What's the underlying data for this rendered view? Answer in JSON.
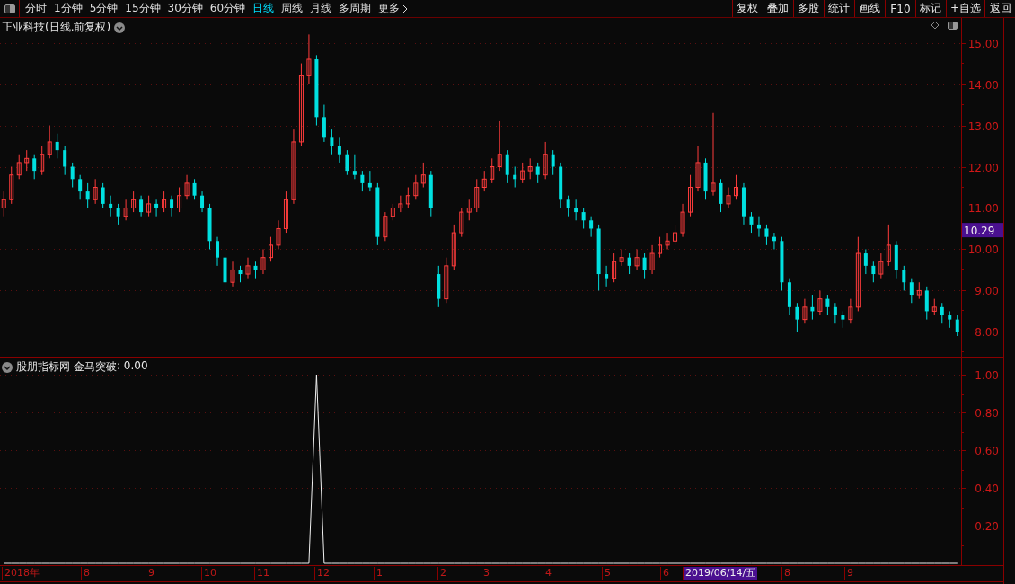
{
  "toolbar": {
    "periods": [
      {
        "label": "分时",
        "selected": false
      },
      {
        "label": "1分钟",
        "selected": false
      },
      {
        "label": "5分钟",
        "selected": false
      },
      {
        "label": "15分钟",
        "selected": false
      },
      {
        "label": "30分钟",
        "selected": false
      },
      {
        "label": "60分钟",
        "selected": false
      },
      {
        "label": "日线",
        "selected": true
      },
      {
        "label": "周线",
        "selected": false
      },
      {
        "label": "月线",
        "selected": false
      },
      {
        "label": "多周期",
        "selected": false
      },
      {
        "label": "更多",
        "selected": false
      }
    ],
    "buttons": [
      "复权",
      "叠加",
      "多股",
      "统计",
      "画线",
      "F10",
      "标记",
      "+自选",
      "返回"
    ]
  },
  "main_chart": {
    "title": "正业科技(日线.前复权)",
    "current_price": "10.29",
    "chart_data": {
      "type": "candlestick",
      "ylim": [
        7.4,
        15.6
      ],
      "yticks": [
        {
          "value": 15,
          "label": "15.00"
        },
        {
          "value": 14,
          "label": "14.00"
        },
        {
          "value": 13,
          "label": "13.00"
        },
        {
          "value": 12,
          "label": "12.00"
        },
        {
          "value": 11,
          "label": "11.00"
        },
        {
          "value": 10,
          "label": "10.00"
        },
        {
          "value": 9,
          "label": "9.00"
        },
        {
          "value": 8,
          "label": "8.00"
        }
      ],
      "grid": true,
      "ohlc": [
        [
          11.0,
          11.4,
          10.8,
          11.2
        ],
        [
          11.2,
          12.0,
          11.1,
          11.8
        ],
        [
          11.8,
          12.3,
          11.7,
          12.1
        ],
        [
          12.1,
          12.4,
          11.9,
          12.2
        ],
        [
          12.2,
          12.3,
          11.7,
          11.9
        ],
        [
          11.9,
          12.5,
          11.8,
          12.3
        ],
        [
          12.3,
          13.0,
          12.2,
          12.6
        ],
        [
          12.6,
          12.8,
          12.2,
          12.4
        ],
        [
          12.4,
          12.5,
          11.8,
          12.0
        ],
        [
          12.0,
          12.1,
          11.5,
          11.7
        ],
        [
          11.7,
          11.8,
          11.2,
          11.4
        ],
        [
          11.4,
          11.6,
          11.0,
          11.2
        ],
        [
          11.2,
          11.7,
          11.1,
          11.5
        ],
        [
          11.5,
          11.6,
          11.0,
          11.1
        ],
        [
          11.1,
          11.3,
          10.8,
          11.0
        ],
        [
          11.0,
          11.1,
          10.6,
          10.8
        ],
        [
          10.8,
          11.2,
          10.7,
          11.0
        ],
        [
          11.0,
          11.4,
          10.9,
          11.2
        ],
        [
          11.2,
          11.3,
          10.8,
          10.9
        ],
        [
          10.9,
          11.3,
          10.8,
          11.1
        ],
        [
          11.1,
          11.2,
          10.8,
          11.0
        ],
        [
          11.0,
          11.4,
          10.9,
          11.2
        ],
        [
          11.2,
          11.3,
          10.8,
          11.0
        ],
        [
          11.0,
          11.5,
          10.9,
          11.3
        ],
        [
          11.3,
          11.8,
          11.2,
          11.6
        ],
        [
          11.6,
          11.7,
          11.2,
          11.3
        ],
        [
          11.3,
          11.4,
          10.9,
          11.0
        ],
        [
          11.0,
          11.1,
          10.0,
          10.2
        ],
        [
          10.2,
          10.3,
          9.6,
          9.8
        ],
        [
          9.8,
          9.9,
          9.0,
          9.2
        ],
        [
          9.2,
          9.7,
          9.1,
          9.5
        ],
        [
          9.5,
          9.6,
          9.2,
          9.4
        ],
        [
          9.4,
          9.8,
          9.3,
          9.6
        ],
        [
          9.6,
          9.7,
          9.3,
          9.5
        ],
        [
          9.5,
          10.0,
          9.4,
          9.8
        ],
        [
          9.8,
          10.3,
          9.7,
          10.1
        ],
        [
          10.1,
          10.7,
          10.0,
          10.5
        ],
        [
          10.5,
          11.4,
          10.4,
          11.2
        ],
        [
          11.2,
          12.9,
          11.1,
          12.6
        ],
        [
          12.6,
          14.5,
          12.5,
          14.2
        ],
        [
          14.2,
          15.2,
          14.0,
          14.6
        ],
        [
          14.6,
          14.7,
          13.0,
          13.2
        ],
        [
          13.2,
          13.5,
          12.6,
          12.7
        ],
        [
          12.7,
          12.9,
          12.3,
          12.5
        ],
        [
          12.5,
          12.7,
          12.1,
          12.3
        ],
        [
          12.3,
          12.4,
          11.8,
          11.9
        ],
        [
          11.9,
          12.3,
          11.7,
          11.8
        ],
        [
          11.8,
          11.9,
          11.4,
          11.6
        ],
        [
          11.6,
          11.9,
          11.4,
          11.5
        ],
        [
          11.5,
          11.6,
          10.1,
          10.3
        ],
        [
          10.3,
          10.9,
          10.2,
          10.8
        ],
        [
          10.8,
          11.1,
          10.7,
          11.0
        ],
        [
          11.0,
          11.3,
          10.9,
          11.1
        ],
        [
          11.1,
          11.5,
          11.0,
          11.3
        ],
        [
          11.3,
          11.8,
          11.2,
          11.6
        ],
        [
          11.6,
          12.1,
          11.5,
          11.8
        ],
        [
          11.8,
          11.9,
          10.8,
          11.0
        ],
        [
          9.4,
          9.6,
          8.6,
          8.8
        ],
        [
          8.8,
          9.8,
          8.7,
          9.6
        ],
        [
          9.6,
          10.6,
          9.5,
          10.4
        ],
        [
          10.4,
          11.0,
          10.3,
          10.9
        ],
        [
          10.9,
          11.2,
          10.7,
          11.0
        ],
        [
          11.0,
          11.7,
          10.9,
          11.5
        ],
        [
          11.5,
          11.9,
          11.4,
          11.7
        ],
        [
          11.7,
          12.2,
          11.6,
          12.0
        ],
        [
          12.0,
          13.1,
          11.9,
          12.3
        ],
        [
          12.3,
          12.4,
          11.6,
          11.8
        ],
        [
          11.8,
          12.0,
          11.5,
          11.7
        ],
        [
          11.7,
          12.1,
          11.6,
          11.9
        ],
        [
          11.9,
          12.2,
          11.7,
          12.0
        ],
        [
          12.0,
          12.1,
          11.6,
          11.8
        ],
        [
          11.8,
          12.6,
          11.7,
          12.3
        ],
        [
          12.3,
          12.4,
          11.8,
          12.0
        ],
        [
          12.0,
          12.1,
          11.0,
          11.2
        ],
        [
          11.2,
          11.3,
          10.8,
          11.0
        ],
        [
          11.0,
          11.2,
          10.7,
          10.9
        ],
        [
          10.9,
          11.0,
          10.5,
          10.7
        ],
        [
          10.7,
          10.8,
          10.3,
          10.5
        ],
        [
          10.5,
          10.6,
          9.0,
          9.4
        ],
        [
          9.4,
          9.6,
          9.1,
          9.3
        ],
        [
          9.3,
          9.9,
          9.2,
          9.7
        ],
        [
          9.7,
          10.0,
          9.6,
          9.8
        ],
        [
          9.8,
          9.9,
          9.4,
          9.6
        ],
        [
          9.6,
          10.0,
          9.5,
          9.8
        ],
        [
          9.8,
          9.9,
          9.3,
          9.5
        ],
        [
          9.5,
          10.1,
          9.4,
          9.9
        ],
        [
          9.9,
          10.3,
          9.8,
          10.1
        ],
        [
          10.1,
          10.4,
          10.0,
          10.2
        ],
        [
          10.2,
          10.6,
          10.1,
          10.4
        ],
        [
          10.4,
          11.1,
          10.3,
          10.9
        ],
        [
          10.9,
          11.8,
          10.8,
          11.5
        ],
        [
          11.5,
          12.5,
          11.4,
          12.1
        ],
        [
          12.1,
          12.2,
          11.2,
          11.4
        ],
        [
          11.4,
          13.3,
          11.3,
          11.6
        ],
        [
          11.6,
          11.7,
          10.9,
          11.1
        ],
        [
          11.1,
          11.5,
          11.0,
          11.3
        ],
        [
          11.3,
          11.8,
          11.2,
          11.5
        ],
        [
          11.5,
          11.6,
          10.6,
          10.8
        ],
        [
          10.8,
          10.9,
          10.4,
          10.6
        ],
        [
          10.6,
          10.8,
          10.3,
          10.5
        ],
        [
          10.5,
          10.6,
          10.1,
          10.3
        ],
        [
          10.3,
          10.4,
          10.0,
          10.2
        ],
        [
          10.2,
          10.3,
          9.0,
          9.2
        ],
        [
          9.2,
          9.3,
          8.4,
          8.6
        ],
        [
          8.6,
          8.7,
          8.0,
          8.3
        ],
        [
          8.3,
          8.8,
          8.2,
          8.6
        ],
        [
          8.6,
          8.9,
          8.3,
          8.5
        ],
        [
          8.5,
          9.0,
          8.4,
          8.8
        ],
        [
          8.8,
          8.9,
          8.4,
          8.6
        ],
        [
          8.6,
          8.7,
          8.2,
          8.4
        ],
        [
          8.4,
          8.5,
          8.1,
          8.3
        ],
        [
          8.3,
          8.8,
          8.2,
          8.6
        ],
        [
          8.6,
          10.3,
          8.5,
          9.9
        ],
        [
          9.9,
          10.0,
          9.4,
          9.6
        ],
        [
          9.6,
          9.7,
          9.2,
          9.4
        ],
        [
          9.4,
          9.9,
          9.3,
          9.7
        ],
        [
          9.7,
          10.6,
          9.6,
          10.1
        ],
        [
          10.1,
          10.2,
          9.3,
          9.5
        ],
        [
          9.5,
          9.6,
          9.0,
          9.2
        ],
        [
          9.2,
          9.3,
          8.7,
          8.9
        ],
        [
          8.9,
          9.2,
          8.8,
          9.0
        ],
        [
          9.0,
          9.1,
          8.3,
          8.5
        ],
        [
          8.5,
          8.8,
          8.4,
          8.6
        ],
        [
          8.6,
          8.7,
          8.2,
          8.4
        ],
        [
          8.4,
          8.5,
          8.1,
          8.3
        ],
        [
          8.3,
          8.4,
          7.9,
          8.0
        ]
      ]
    }
  },
  "indicator": {
    "title": "股朋指标网",
    "reading": ": 0.00",
    "chart_data": {
      "type": "line",
      "ylim": [
        0,
        1.1
      ],
      "grid": true,
      "yticks": [
        {
          "value": 1,
          "label": "1.00"
        },
        {
          "value": 0.8,
          "label": "0.80"
        },
        {
          "value": 0.6,
          "label": "0.60"
        },
        {
          "value": 0.4,
          "label": "0.40"
        },
        {
          "value": 0.2,
          "label": "0.20"
        }
      ],
      "series": [
        {
          "name": "金马突破",
          "color": "#f0f0f0",
          "values": [
            0,
            0,
            0,
            0,
            0,
            0,
            0,
            0,
            0,
            0,
            0,
            0,
            0,
            0,
            0,
            0,
            0,
            0,
            0,
            0,
            0,
            0,
            0,
            0,
            0,
            0,
            0,
            0,
            0,
            0,
            0,
            0,
            0,
            0,
            0,
            0,
            0,
            0,
            0,
            0,
            0,
            1,
            0,
            0,
            0,
            0,
            0,
            0,
            0,
            0,
            0,
            0,
            0,
            0,
            0,
            0,
            0,
            0,
            0,
            0,
            0,
            0,
            0,
            0,
            0,
            0,
            0,
            0,
            0,
            0,
            0,
            0,
            0,
            0,
            0,
            0,
            0,
            0,
            0,
            0,
            0,
            0,
            0,
            0,
            0,
            0,
            0,
            0,
            0,
            0,
            0,
            0,
            0,
            0,
            0,
            0,
            0,
            0,
            0,
            0,
            0,
            0,
            0,
            0,
            0,
            0,
            0,
            0,
            0,
            0,
            0,
            0,
            0,
            0,
            0,
            0,
            0,
            0,
            0,
            0,
            0,
            0,
            0,
            0,
            0,
            0
          ]
        }
      ]
    }
  },
  "date_axis": {
    "labels": [
      {
        "text": "2018年",
        "selected": false
      },
      {
        "text": "8",
        "selected": false
      },
      {
        "text": "9",
        "selected": false
      },
      {
        "text": "10",
        "selected": false
      },
      {
        "text": "11",
        "selected": false
      },
      {
        "text": "12",
        "selected": false
      },
      {
        "text": "1",
        "selected": false
      },
      {
        "text": "2",
        "selected": false
      },
      {
        "text": "3",
        "selected": false
      },
      {
        "text": "4",
        "selected": false
      },
      {
        "text": "5",
        "selected": false
      },
      {
        "text": "6",
        "selected": false
      },
      {
        "text": "2019/06/14/五",
        "selected": true
      },
      {
        "text": "8",
        "selected": false
      },
      {
        "text": "9",
        "selected": false
      }
    ]
  }
}
